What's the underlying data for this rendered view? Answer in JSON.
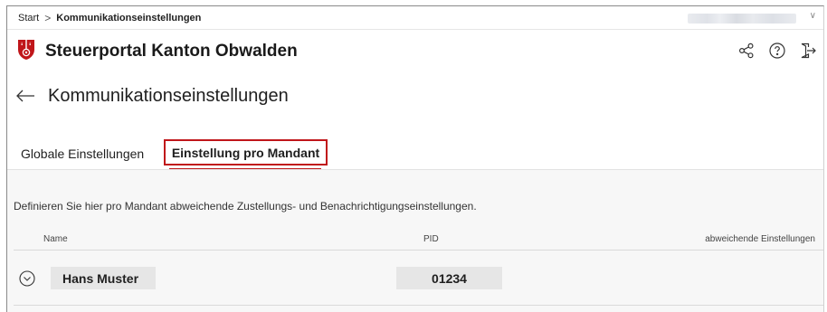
{
  "breadcrumb": {
    "start": "Start",
    "separator": ">",
    "current": "Kommunikationseinstellungen"
  },
  "user_menu": {
    "chevron": "∨"
  },
  "header": {
    "title": "Steuerportal Kanton Obwalden"
  },
  "page": {
    "title": "Kommunikationseinstellungen"
  },
  "tabs": [
    {
      "label": "Globale Einstellungen",
      "selected": false
    },
    {
      "label": "Einstellung pro Mandant",
      "selected": true
    }
  ],
  "content": {
    "description": "Definieren Sie hier pro Mandant abweichende Zustellungs- und Benachrichtigungseinstellungen.",
    "columns": {
      "name": "Name",
      "pid": "PID",
      "diff": "abweichende Einstellungen"
    },
    "rows": [
      {
        "name": "Hans Muster",
        "pid": "01234"
      }
    ]
  },
  "icons": [
    "share-icon",
    "help-icon",
    "logout-icon",
    "back-arrow-icon",
    "expand-circle-icon",
    "canton-logo"
  ],
  "colors": {
    "accent": "#c0161a",
    "content_bg": "#f7f7f7",
    "cell_bg": "#e6e6e6"
  }
}
